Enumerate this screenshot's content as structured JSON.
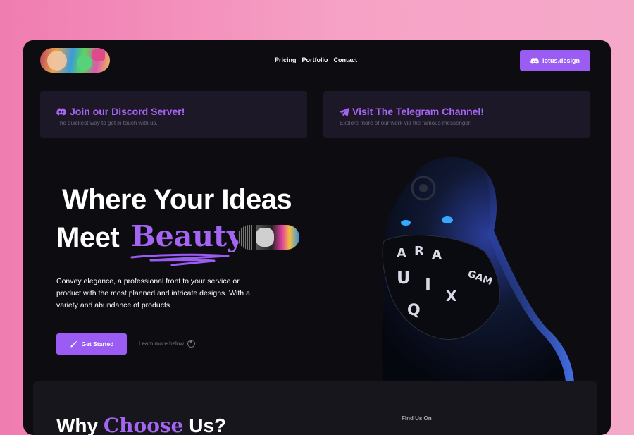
{
  "nav": {
    "links": [
      "Pricing",
      "Portfolio",
      "Contact"
    ],
    "cta_label": "lotus.design"
  },
  "cards": [
    {
      "title": "Join our Discord Server!",
      "subtitle": "The quickest way to get in touch with us.",
      "icon": "discord-icon"
    },
    {
      "title": "Visit The Telegram Channel!",
      "subtitle": "Explore more of our work via the famous messenger.",
      "icon": "telegram-icon"
    }
  ],
  "hero": {
    "line1": "Where Your Ideas",
    "line2": "Meet",
    "accent": "Beauty",
    "description": "Convey elegance, a professional front to your service or product with the most planned and intricate designs. With a variety and abundance of products",
    "primary_button": "Get Started",
    "secondary_link": "Learn more below"
  },
  "bottom": {
    "heading": "Why",
    "heading_accent": "Choose",
    "heading_end": "Us?",
    "find_label": "Find Us On"
  },
  "colors": {
    "accent": "#9a5cf2",
    "background": "#0d0c11",
    "card": "#1d1827"
  }
}
